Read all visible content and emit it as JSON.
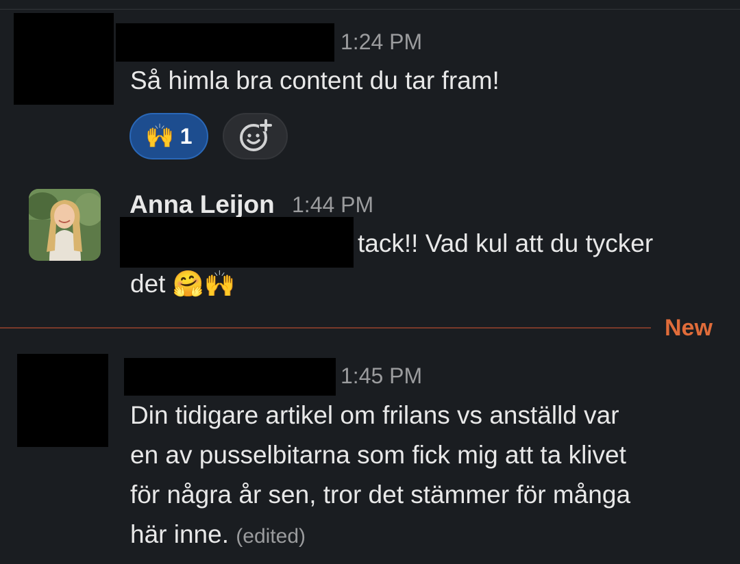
{
  "messages": [
    {
      "timestamp": "1:24 PM",
      "text": "Så himla bra content du tar fram!",
      "reactions": [
        {
          "emoji": "🙌",
          "count": "1",
          "active": true
        }
      ],
      "add_reaction_icon": "add-reaction-icon"
    },
    {
      "author": "Anna Leijon",
      "timestamp": "1:44 PM",
      "text_line1": "tack!! Vad kul att du tycker",
      "text_line2": "det 🤗🙌"
    },
    {
      "timestamp": "1:45 PM",
      "text_lines": [
        "Din tidigare artikel om frilans vs anställd var",
        "en av pusselbitarna som fick mig att ta klivet",
        "för några år sen, tror det stämmer för många",
        "här inne."
      ],
      "edited_label": "(edited)"
    }
  ],
  "divider": {
    "label": "New",
    "color": "#e06c3a"
  },
  "colors": {
    "background": "#1a1d21",
    "text": "#e8e8e8",
    "muted": "#9b9c9e",
    "reaction_active": "#1d4d8f"
  }
}
